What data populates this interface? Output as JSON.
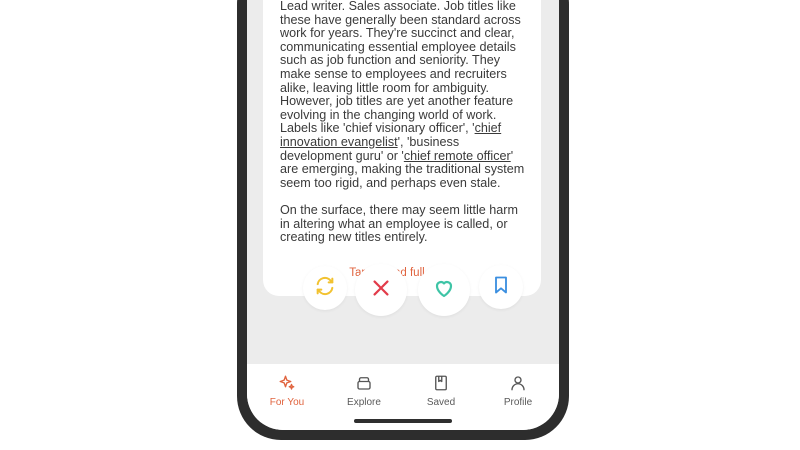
{
  "article": {
    "p1": {
      "text_a": "Lead writer. Sales associate. Job titles like these have generally been standard across work for years. They're succinct and clear, communicating essential employee details such as job function and seniority. They make sense to employees and recruiters alike, leaving little room for ambiguity. However, job titles are yet another feature evolving in the changing world of work. Labels like 'chief visionary officer', '",
      "link_a": "chief innovation evangelist",
      "text_b": "', 'business development guru' or '",
      "link_b": "chief remote officer",
      "text_c": "' are emerging, making the traditional system seem too rigid, and perhaps even stale."
    },
    "p2": "On the surface, there may seem little harm in altering what an employee is called, or creating new titles entirely.",
    "read_more": "Tap to read full news"
  },
  "actions": [
    {
      "name": "refresh-icon",
      "color": "#f2c230"
    },
    {
      "name": "close-icon",
      "color": "#e23b4a"
    },
    {
      "name": "heart-icon",
      "color": "#3ec4a6"
    },
    {
      "name": "bookmark-icon",
      "color": "#3b8fe0"
    }
  ],
  "nav": {
    "items": [
      {
        "label": "For You",
        "icon": "sparkle-icon",
        "active": true
      },
      {
        "label": "Explore",
        "icon": "explore-icon",
        "active": false
      },
      {
        "label": "Saved",
        "icon": "book-icon",
        "active": false
      },
      {
        "label": "Profile",
        "icon": "person-icon",
        "active": false
      }
    ]
  },
  "colors": {
    "accent": "#e0633e",
    "phone_frame": "#2d2d2d",
    "screen_bg": "#ececec"
  }
}
